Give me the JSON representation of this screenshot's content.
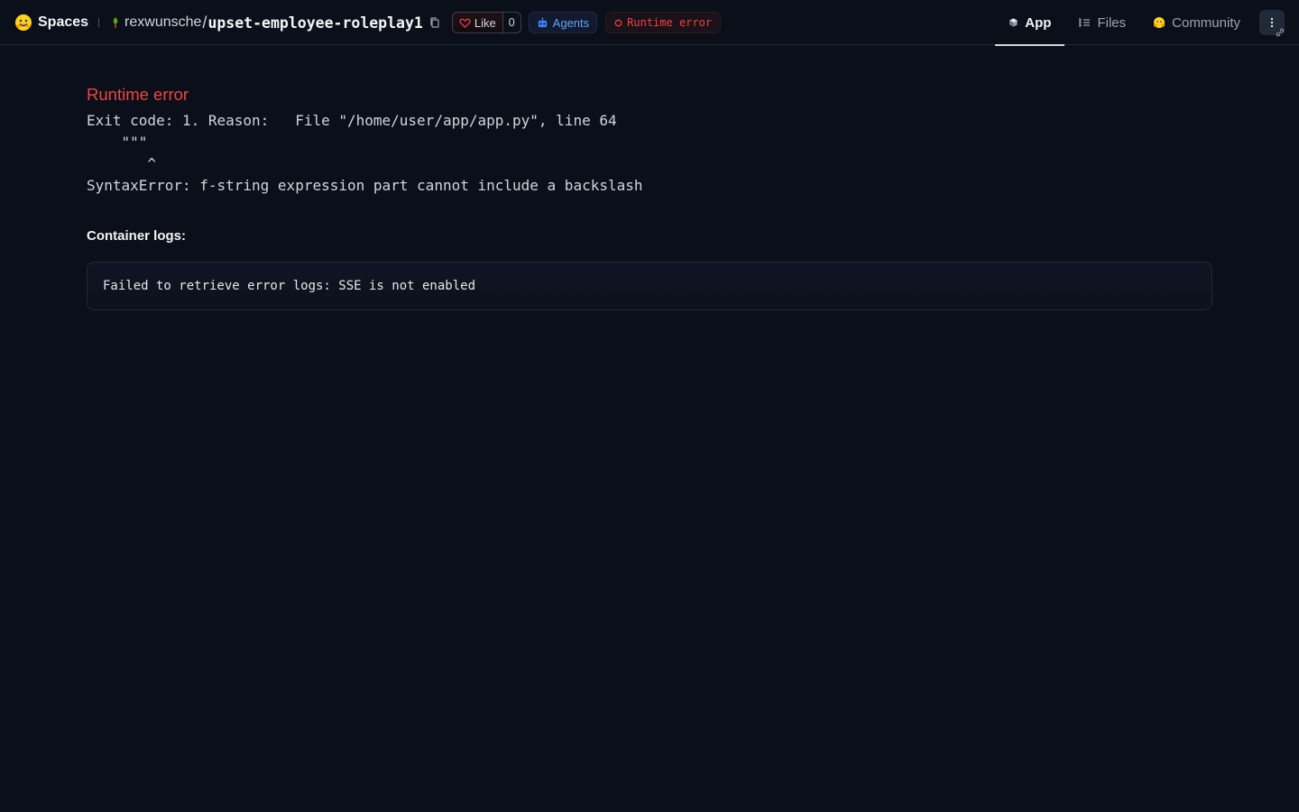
{
  "header": {
    "brand_label": "Spaces",
    "owner": "rexwunsche",
    "separator": "/",
    "repo_name": "upset-employee-roleplay1",
    "like_label": "Like",
    "like_count": "0",
    "agents_label": "Agents",
    "status_label": "Runtime error",
    "status_color": "#ef4444",
    "tabs": [
      {
        "label": "App",
        "icon": "cube-icon",
        "active": true
      },
      {
        "label": "Files",
        "icon": "file-tree-icon",
        "active": false
      },
      {
        "label": "Community",
        "icon": "hf-emoji-icon",
        "active": false
      }
    ]
  },
  "main": {
    "error_title": "Runtime error",
    "error_lines": [
      "Exit code: 1. Reason:   File \"/home/user/app/app.py\", line 64",
      "    \"\"\"",
      "       ^",
      "SyntaxError: f-string expression part cannot include a backslash"
    ],
    "logs_title": "Container logs:",
    "logs_text": "Failed to retrieve error logs: SSE is not enabled"
  }
}
